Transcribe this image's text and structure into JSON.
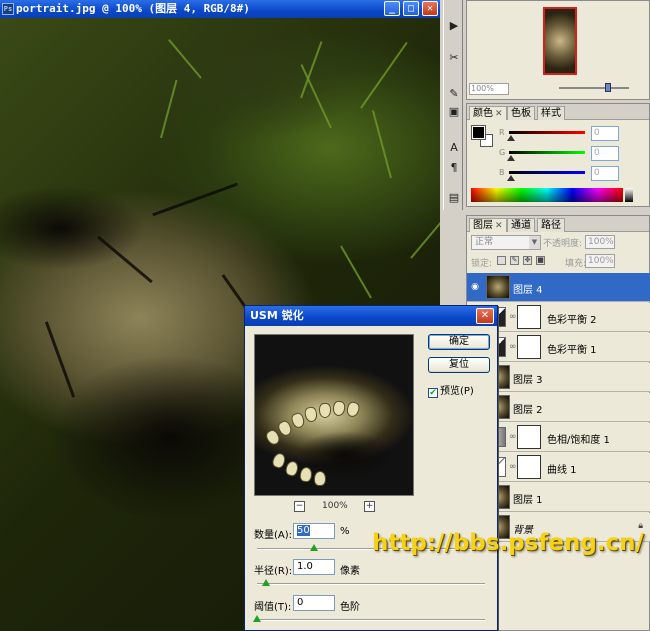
{
  "document": {
    "title": "portrait.jpg @ 100% (图层 4, RGB/8#)",
    "controls": {
      "minimize": "_",
      "maximize": "□",
      "close": "✕"
    }
  },
  "navigator": {
    "zoom": "100%"
  },
  "color_panel": {
    "tabs": [
      "颜色",
      "色板",
      "样式"
    ],
    "channels": [
      {
        "label": "R",
        "value": "0",
        "color": "#d01010"
      },
      {
        "label": "G",
        "value": "0",
        "color": "#10b020"
      },
      {
        "label": "B",
        "value": "0",
        "color": "#1020c0"
      }
    ]
  },
  "layers_panel": {
    "tabs": [
      "图层",
      "通道",
      "路径"
    ],
    "blend_mode": "正常",
    "opacity_label": "不透明度:",
    "opacity": "100%",
    "lock_label": "锁定:",
    "fill_label": "填充:",
    "fill": "100%",
    "layers": [
      {
        "name": "图层 4",
        "selected": true
      },
      {
        "name": "色彩平衡 2",
        "selected": false
      },
      {
        "name": "色彩平衡 1",
        "selected": false
      },
      {
        "name": "图层 3",
        "selected": false
      },
      {
        "name": "图层 2",
        "selected": false
      },
      {
        "name": "色相/饱和度 1",
        "selected": false
      },
      {
        "name": "曲线 1",
        "selected": false
      },
      {
        "name": "图层 1",
        "selected": false
      },
      {
        "name": "背景",
        "selected": false
      }
    ]
  },
  "usm_dialog": {
    "title": "USM 锐化",
    "ok": "确定",
    "reset": "复位",
    "preview_label": "预览(P)",
    "preview_checked": true,
    "zoom": "100%",
    "amount_label": "数量(A):",
    "amount": "50",
    "amount_unit": "%",
    "amount_fraction": 0.25,
    "radius_label": "半径(R):",
    "radius": "1.0",
    "radius_unit": "像素",
    "radius_fraction": 0.04,
    "threshold_label": "阈值(T):",
    "threshold": "0",
    "threshold_unit": "色阶",
    "threshold_fraction": 0.0
  },
  "watermark": "http://bbs.psfeng.cn/",
  "colors": {
    "titlebar": "#0a47c9",
    "selection": "#3169c6",
    "watermark": "#f4d21a"
  }
}
